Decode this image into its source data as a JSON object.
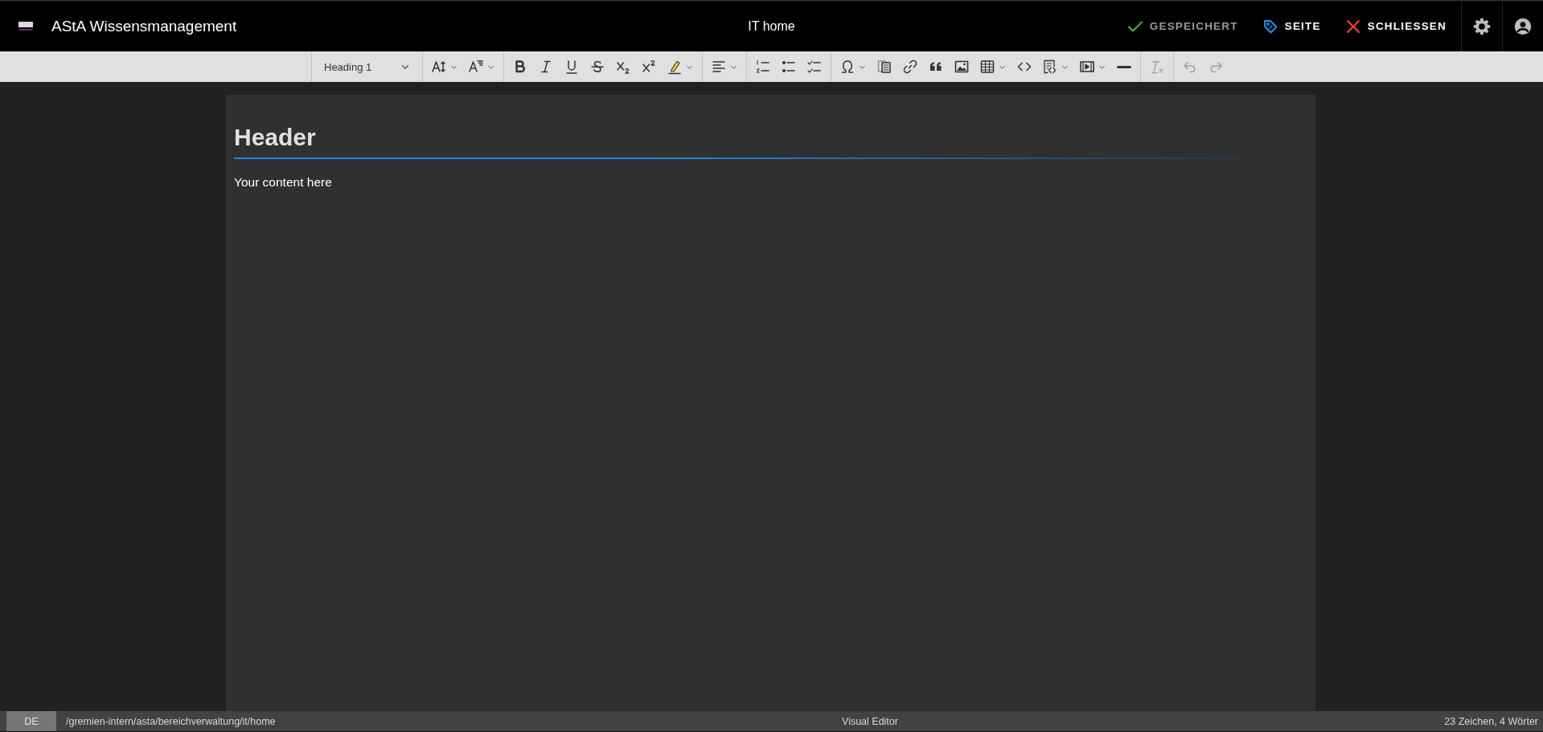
{
  "header": {
    "app_title": "AStA Wissensmanagement",
    "page_title": "IT home",
    "actions": [
      {
        "label": "GESPEICHERT",
        "kind": "saved",
        "disabled": true
      },
      {
        "label": "SEITE",
        "kind": "page",
        "disabled": false
      },
      {
        "label": "SCHLIESSEN",
        "kind": "close",
        "disabled": false
      }
    ]
  },
  "toolbar": {
    "groups": [
      {
        "items": [
          {
            "kind": "select",
            "value": "Heading 1",
            "disabled": false
          }
        ]
      },
      {
        "items": [
          {
            "kind": "dropdown",
            "disabled": false
          },
          {
            "kind": "dropdown",
            "disabled": false
          }
        ]
      },
      {
        "items": [
          {
            "kind": "button",
            "disabled": false
          },
          {
            "kind": "button",
            "disabled": false
          },
          {
            "kind": "button",
            "disabled": false
          },
          {
            "kind": "button",
            "disabled": false
          },
          {
            "kind": "button",
            "disabled": false
          },
          {
            "kind": "button",
            "disabled": false
          },
          {
            "kind": "dropdown",
            "disabled": false
          }
        ]
      },
      {
        "items": [
          {
            "kind": "dropdown",
            "disabled": false
          }
        ]
      },
      {
        "items": [
          {
            "kind": "button",
            "disabled": false
          },
          {
            "kind": "button",
            "disabled": false
          },
          {
            "kind": "button",
            "disabled": false
          }
        ]
      },
      {
        "items": [
          {
            "kind": "dropdown",
            "disabled": false
          },
          {
            "kind": "button",
            "disabled": false
          },
          {
            "kind": "button",
            "disabled": false
          },
          {
            "kind": "button",
            "disabled": false
          },
          {
            "kind": "button",
            "disabled": false
          },
          {
            "kind": "dropdown",
            "disabled": false
          },
          {
            "kind": "button",
            "disabled": false
          },
          {
            "kind": "dropdown",
            "disabled": false
          },
          {
            "kind": "dropdown",
            "disabled": false
          },
          {
            "kind": "button",
            "disabled": false
          }
        ]
      },
      {
        "items": [
          {
            "kind": "button",
            "disabled": true
          }
        ]
      },
      {
        "items": [
          {
            "kind": "button",
            "disabled": true
          },
          {
            "kind": "button",
            "disabled": true
          }
        ]
      }
    ]
  },
  "document": {
    "heading": "Header",
    "paragraph": "Your content here"
  },
  "status_bar": {
    "language": "DE",
    "path": "/gremien-intern/asta/bereichverwaltung/it/home",
    "mode": "Visual Editor",
    "counts": "23 Zeichen, 4 Wörter"
  }
}
